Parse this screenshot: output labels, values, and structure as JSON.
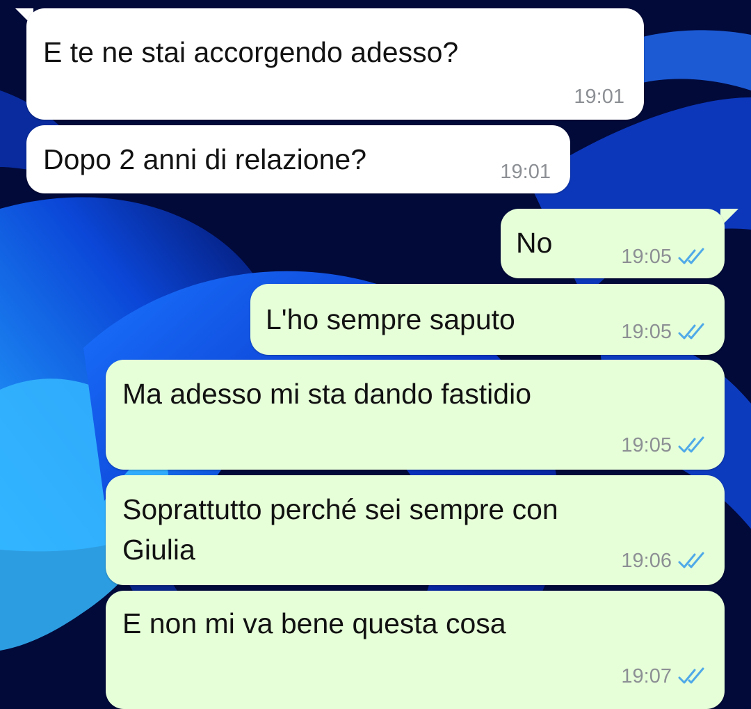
{
  "conversation": {
    "messages": [
      {
        "direction": "incoming",
        "text": "E te ne stai accorgendo adesso?",
        "time": "19:01"
      },
      {
        "direction": "incoming",
        "text": "Dopo 2 anni di relazione?",
        "time": "19:01"
      },
      {
        "direction": "outgoing",
        "text": "No",
        "time": "19:05",
        "status_icon": "double-check-read-icon"
      },
      {
        "direction": "outgoing",
        "text": "L'ho sempre saputo",
        "time": "19:05",
        "status_icon": "double-check-read-icon"
      },
      {
        "direction": "outgoing",
        "text": "Ma adesso mi sta dando fastidio",
        "time": "19:05",
        "status_icon": "double-check-read-icon"
      },
      {
        "direction": "outgoing",
        "text_line1": "Soprattutto perché sei sempre con",
        "text_line2": "Giulia",
        "time": "19:06",
        "status_icon": "double-check-read-icon"
      },
      {
        "direction": "outgoing",
        "text": "E non mi va bene questa cosa",
        "time": "19:07",
        "status_icon": "double-check-read-icon"
      }
    ]
  },
  "colors": {
    "incoming_bubble": "#ffffff",
    "outgoing_bubble": "#e6ffd8",
    "read_ticks": "#4fa9e8",
    "timestamp": "#8c8f94",
    "wallpaper_base": "#020a3a",
    "wallpaper_swirl": "#1f63e6"
  }
}
